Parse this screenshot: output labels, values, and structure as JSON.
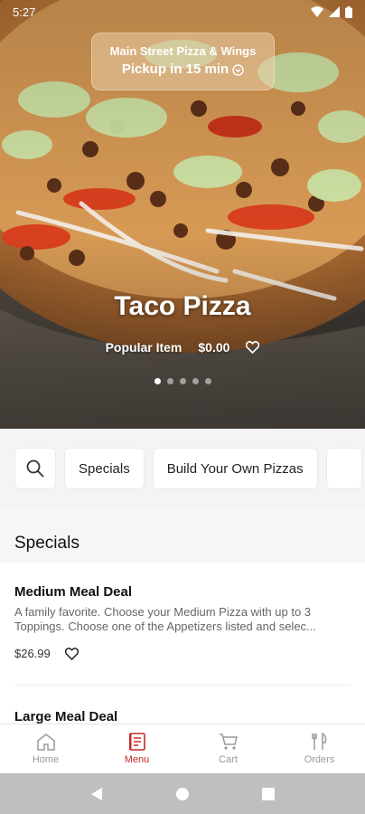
{
  "status": {
    "time": "5:27"
  },
  "hero": {
    "store_name": "Main Street Pizza & Wings",
    "pickup_text": "Pickup in 15 min",
    "title": "Taco Pizza",
    "badge": "Popular Item",
    "price": "$0.00",
    "carousel_count": 5,
    "carousel_active": 0
  },
  "categories": {
    "items": [
      "Specials",
      "Build Your Own Pizzas"
    ]
  },
  "section": {
    "title": "Specials"
  },
  "items": [
    {
      "name": "Medium Meal Deal",
      "desc_line1": "A family favorite.  Choose your Medium Pizza with up to 3",
      "desc_line2": "Toppings.  Choose one of the Appetizers listed and selec...",
      "price": "$26.99"
    },
    {
      "name": "Large Meal Deal"
    }
  ],
  "nav": [
    {
      "label": "Home",
      "icon": "home-icon"
    },
    {
      "label": "Menu",
      "icon": "menu-icon"
    },
    {
      "label": "Cart",
      "icon": "cart-icon"
    },
    {
      "label": "Orders",
      "icon": "orders-icon"
    }
  ],
  "colors": {
    "accent": "#c62828",
    "nav_inactive": "#9a9a9a"
  }
}
